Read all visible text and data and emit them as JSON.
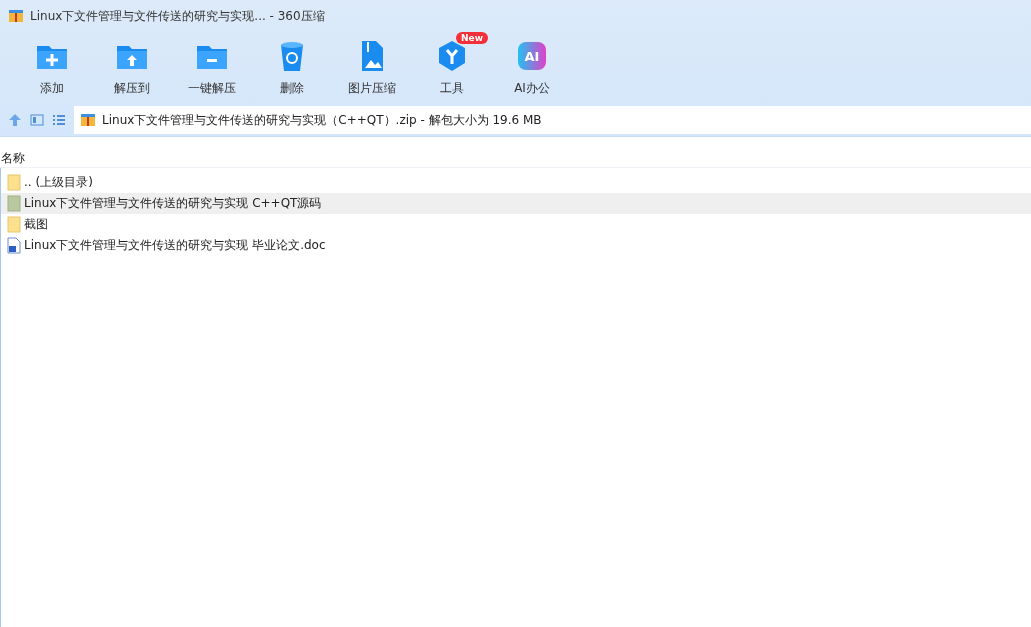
{
  "window": {
    "title": "Linux下文件管理与文件传送的研究与实现... - 360压缩"
  },
  "toolbar": [
    {
      "label": "添加",
      "kind": "add"
    },
    {
      "label": "解压到",
      "kind": "extract"
    },
    {
      "label": "一键解压",
      "kind": "oneclick"
    },
    {
      "label": "删除",
      "kind": "delete"
    },
    {
      "label": "图片压缩",
      "kind": "image"
    },
    {
      "label": "工具",
      "kind": "tools",
      "badge": "New"
    },
    {
      "label": "AI办公",
      "kind": "ai",
      "icon_text": "AI"
    }
  ],
  "address_bar": {
    "path": "Linux下文件管理与文件传送的研究与实现（C++QT）.zip - 解包大小为 19.6 MB"
  },
  "table": {
    "columns": [
      "名称"
    ],
    "rows": [
      {
        "name": ".. (上级目录)",
        "kind": "folder",
        "selected": false
      },
      {
        "name": "Linux下文件管理与文件传送的研究与实现 C++QT源码",
        "kind": "folder",
        "selected": true
      },
      {
        "name": "截图",
        "kind": "folder",
        "selected": false
      },
      {
        "name": "Linux下文件管理与文件传送的研究与实现 毕业论文.doc",
        "kind": "doc",
        "selected": false
      }
    ]
  }
}
